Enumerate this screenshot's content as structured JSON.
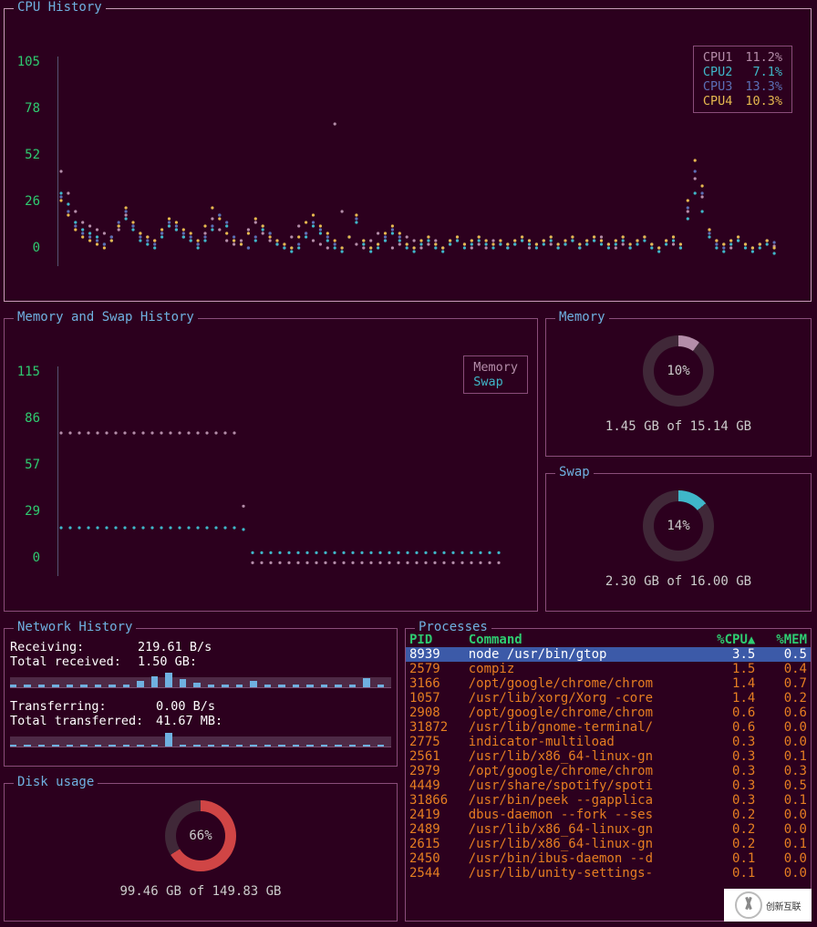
{
  "cpu": {
    "title": "CPU History",
    "axis": [
      "105",
      "78",
      "52",
      "26",
      "0"
    ],
    "legend": [
      {
        "name": "CPU1",
        "pct": "11.2%",
        "color": "#b48da9"
      },
      {
        "name": "CPU2",
        "pct": "7.1%",
        "color": "#3fb7c9"
      },
      {
        "name": "CPU3",
        "pct": "13.3%",
        "color": "#5b6fb5"
      },
      {
        "name": "CPU4",
        "pct": "10.3%",
        "color": "#e6b84f"
      }
    ]
  },
  "memswap": {
    "title": "Memory and Swap History",
    "axis": [
      "115",
      "86",
      "57",
      "29",
      "0"
    ],
    "legend": [
      {
        "name": "Memory",
        "color": "#b48da9"
      },
      {
        "name": "Swap",
        "color": "#3fb7c9"
      }
    ]
  },
  "memory": {
    "title": "Memory",
    "pct": "10%",
    "line": "1.45 GB of 15.14 GB"
  },
  "swap": {
    "title": "Swap",
    "pct": "14%",
    "line": "2.30 GB of 16.00 GB"
  },
  "network": {
    "title": "Network History",
    "rx_label": "Receiving:",
    "rx_value": "219.61  B/s",
    "rx_total_label": "Total received:",
    "rx_total_value": "1.50 GB:",
    "tx_label": "Transferring:",
    "tx_value": "0.00 B/s",
    "tx_total_label": "Total transferred:",
    "tx_total_value": "41.67 MB:"
  },
  "disk": {
    "title": "Disk usage",
    "pct": "66%",
    "line": "99.46 GB of 149.83 GB"
  },
  "processes": {
    "title": "Processes",
    "headers": {
      "pid": "PID",
      "cmd": "Command",
      "cpu": "%CPU▲",
      "mem": "%MEM"
    },
    "rows": [
      {
        "pid": "8939",
        "cmd": "node /usr/bin/gtop",
        "cpu": "3.5",
        "mem": "0.5",
        "sel": true
      },
      {
        "pid": "2579",
        "cmd": "compiz",
        "cpu": "1.5",
        "mem": "0.4"
      },
      {
        "pid": "3166",
        "cmd": "/opt/google/chrome/chrom",
        "cpu": "1.4",
        "mem": "0.7"
      },
      {
        "pid": "1057",
        "cmd": "/usr/lib/xorg/Xorg -core",
        "cpu": "1.4",
        "mem": "0.2"
      },
      {
        "pid": "2908",
        "cmd": "/opt/google/chrome/chrom",
        "cpu": "0.6",
        "mem": "0.6"
      },
      {
        "pid": "31872",
        "cmd": "/usr/lib/gnome-terminal/",
        "cpu": "0.6",
        "mem": "0.0"
      },
      {
        "pid": "2775",
        "cmd": "indicator-multiload",
        "cpu": "0.3",
        "mem": "0.0"
      },
      {
        "pid": "2561",
        "cmd": "/usr/lib/x86_64-linux-gn",
        "cpu": "0.3",
        "mem": "0.1"
      },
      {
        "pid": "2979",
        "cmd": "/opt/google/chrome/chrom",
        "cpu": "0.3",
        "mem": "0.3"
      },
      {
        "pid": "4449",
        "cmd": "/usr/share/spotify/spoti",
        "cpu": "0.3",
        "mem": "0.5"
      },
      {
        "pid": "31866",
        "cmd": "/usr/bin/peek --gapplica",
        "cpu": "0.3",
        "mem": "0.1"
      },
      {
        "pid": "2419",
        "cmd": "dbus-daemon --fork --ses",
        "cpu": "0.2",
        "mem": "0.0"
      },
      {
        "pid": "2489",
        "cmd": "/usr/lib/x86_64-linux-gn",
        "cpu": "0.2",
        "mem": "0.0"
      },
      {
        "pid": "2615",
        "cmd": "/usr/lib/x86_64-linux-gn",
        "cpu": "0.2",
        "mem": "0.1"
      },
      {
        "pid": "2450",
        "cmd": "/usr/bin/ibus-daemon --d",
        "cpu": "0.1",
        "mem": "0.0"
      },
      {
        "pid": "2544",
        "cmd": "/usr/lib/unity-settings-",
        "cpu": "0.1",
        "mem": "0.0"
      }
    ]
  },
  "watermark": "创新互联",
  "chart_data": [
    {
      "type": "line",
      "title": "CPU History",
      "ylabel": "%",
      "ylim": [
        0,
        105
      ],
      "x": "time (samples, oldest→newest)",
      "series": [
        {
          "name": "CPU1",
          "color": "#b48da9",
          "values": [
            52,
            40,
            30,
            24,
            22,
            20,
            18,
            16,
            20,
            28,
            22,
            18,
            16,
            14,
            18,
            22,
            20,
            16,
            14,
            12,
            18,
            26,
            20,
            14,
            12,
            14,
            20,
            24,
            18,
            14,
            12,
            10,
            16,
            22,
            18,
            14,
            12,
            10,
            78,
            30,
            16,
            12,
            10,
            14,
            18,
            14,
            10,
            12,
            16,
            14,
            10,
            12,
            14,
            10,
            12,
            14,
            12,
            10,
            12,
            10,
            14,
            12,
            10,
            12,
            14,
            10,
            12,
            14,
            12,
            10,
            12,
            14,
            10,
            12,
            14,
            16,
            12,
            10,
            12,
            10,
            14,
            16,
            12,
            10,
            14,
            12,
            10,
            30,
            48,
            38,
            20,
            14,
            12,
            10,
            14,
            12,
            10,
            12,
            14,
            11
          ]
        },
        {
          "name": "CPU2",
          "color": "#3fb7c9",
          "values": [
            40,
            34,
            24,
            20,
            18,
            16,
            12,
            14,
            22,
            26,
            20,
            14,
            12,
            10,
            16,
            22,
            20,
            16,
            14,
            10,
            14,
            20,
            28,
            22,
            14,
            12,
            10,
            14,
            20,
            18,
            12,
            10,
            8,
            10,
            16,
            22,
            18,
            14,
            10,
            8,
            16,
            24,
            12,
            8,
            10,
            14,
            18,
            14,
            10,
            8,
            12,
            14,
            10,
            8,
            12,
            14,
            10,
            12,
            14,
            12,
            10,
            12,
            10,
            12,
            14,
            12,
            10,
            12,
            14,
            10,
            12,
            14,
            10,
            12,
            14,
            12,
            10,
            12,
            14,
            10,
            12,
            14,
            10,
            8,
            12,
            14,
            10,
            26,
            40,
            30,
            16,
            10,
            8,
            12,
            14,
            10,
            8,
            10,
            12,
            7
          ]
        },
        {
          "name": "CPU3",
          "color": "#5b6fb5",
          "values": [
            38,
            30,
            22,
            18,
            16,
            14,
            12,
            16,
            24,
            30,
            22,
            16,
            14,
            12,
            18,
            24,
            22,
            18,
            16,
            12,
            16,
            22,
            28,
            24,
            16,
            12,
            10,
            16,
            22,
            18,
            14,
            12,
            10,
            12,
            18,
            24,
            20,
            16,
            12,
            10,
            16,
            26,
            14,
            10,
            12,
            16,
            20,
            16,
            12,
            10,
            14,
            16,
            12,
            10,
            14,
            16,
            12,
            14,
            16,
            14,
            12,
            14,
            12,
            14,
            16,
            14,
            12,
            14,
            16,
            12,
            14,
            16,
            12,
            14,
            16,
            14,
            12,
            14,
            16,
            12,
            14,
            16,
            12,
            10,
            14,
            16,
            12,
            32,
            52,
            40,
            18,
            12,
            10,
            14,
            16,
            12,
            10,
            12,
            14,
            13
          ]
        },
        {
          "name": "CPU4",
          "color": "#e6b84f",
          "values": [
            36,
            28,
            20,
            16,
            14,
            12,
            10,
            14,
            22,
            32,
            24,
            18,
            16,
            14,
            20,
            26,
            24,
            20,
            18,
            14,
            22,
            32,
            26,
            18,
            14,
            12,
            18,
            26,
            22,
            16,
            14,
            12,
            10,
            16,
            24,
            28,
            22,
            18,
            14,
            10,
            16,
            28,
            14,
            10,
            12,
            18,
            22,
            18,
            12,
            10,
            14,
            16,
            12,
            10,
            14,
            16,
            12,
            14,
            16,
            14,
            12,
            14,
            12,
            14,
            16,
            14,
            12,
            14,
            16,
            12,
            14,
            16,
            12,
            14,
            16,
            14,
            12,
            14,
            16,
            12,
            14,
            16,
            12,
            10,
            14,
            16,
            12,
            36,
            58,
            44,
            20,
            14,
            12,
            14,
            16,
            12,
            10,
            12,
            14,
            10
          ]
        }
      ]
    },
    {
      "type": "line",
      "title": "Memory and Swap History",
      "ylim": [
        0,
        115
      ],
      "series": [
        {
          "name": "Memory",
          "color": "#b48da9",
          "values": [
            86,
            86,
            86,
            86,
            86,
            86,
            86,
            86,
            86,
            86,
            86,
            86,
            86,
            86,
            86,
            86,
            86,
            86,
            86,
            86,
            42,
            8,
            8,
            8,
            8,
            8,
            8,
            8,
            8,
            8,
            8,
            8,
            8,
            8,
            8,
            8,
            8,
            8,
            8,
            8,
            8,
            8,
            8,
            8,
            8,
            8,
            8,
            8,
            8
          ]
        },
        {
          "name": "Swap",
          "color": "#3fb7c9",
          "values": [
            29,
            29,
            29,
            29,
            29,
            29,
            29,
            29,
            29,
            29,
            29,
            29,
            29,
            29,
            29,
            29,
            29,
            29,
            29,
            29,
            28,
            14,
            14,
            14,
            14,
            14,
            14,
            14,
            14,
            14,
            14,
            14,
            14,
            14,
            14,
            14,
            14,
            14,
            14,
            14,
            14,
            14,
            14,
            14,
            14,
            14,
            14,
            14,
            14
          ]
        }
      ]
    }
  ]
}
